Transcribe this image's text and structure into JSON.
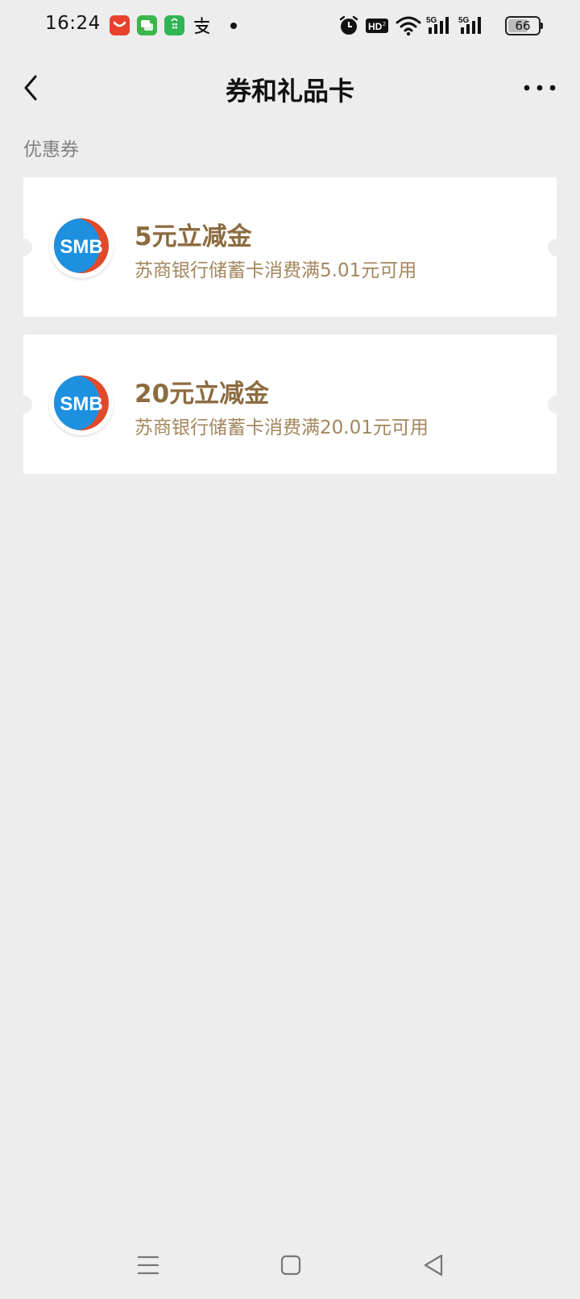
{
  "status_bar": {
    "time": "16:24",
    "notification_icons": [
      "shopping-bag-app-icon",
      "chat-bubbles-app-icon",
      "shopping-bag-green-app-icon",
      "alipay-icon"
    ],
    "system_icons": [
      "alarm-icon",
      "hd-icon",
      "wifi-icon",
      "signal-5g-icon",
      "signal-5g-icon"
    ],
    "hd_label": "HD",
    "network_label": "5G",
    "battery_level": 66,
    "battery_label": "66"
  },
  "nav": {
    "title": "券和礼品卡"
  },
  "section": {
    "label": "优惠券"
  },
  "coupons": [
    {
      "title": "5元立减金",
      "description": "苏商银行储蓄卡消费满5.01元可用",
      "logo_text": "SMB"
    },
    {
      "title": "20元立减金",
      "description": "苏商银行储蓄卡消费满20.01元可用",
      "logo_text": "SMB"
    }
  ],
  "colors": {
    "background": "#ededed",
    "card": "#ffffff",
    "coupon_title": "#8c6b3f",
    "coupon_desc": "#a3865c",
    "logo_blue": "#1e90e0",
    "logo_red": "#e04a2a"
  }
}
